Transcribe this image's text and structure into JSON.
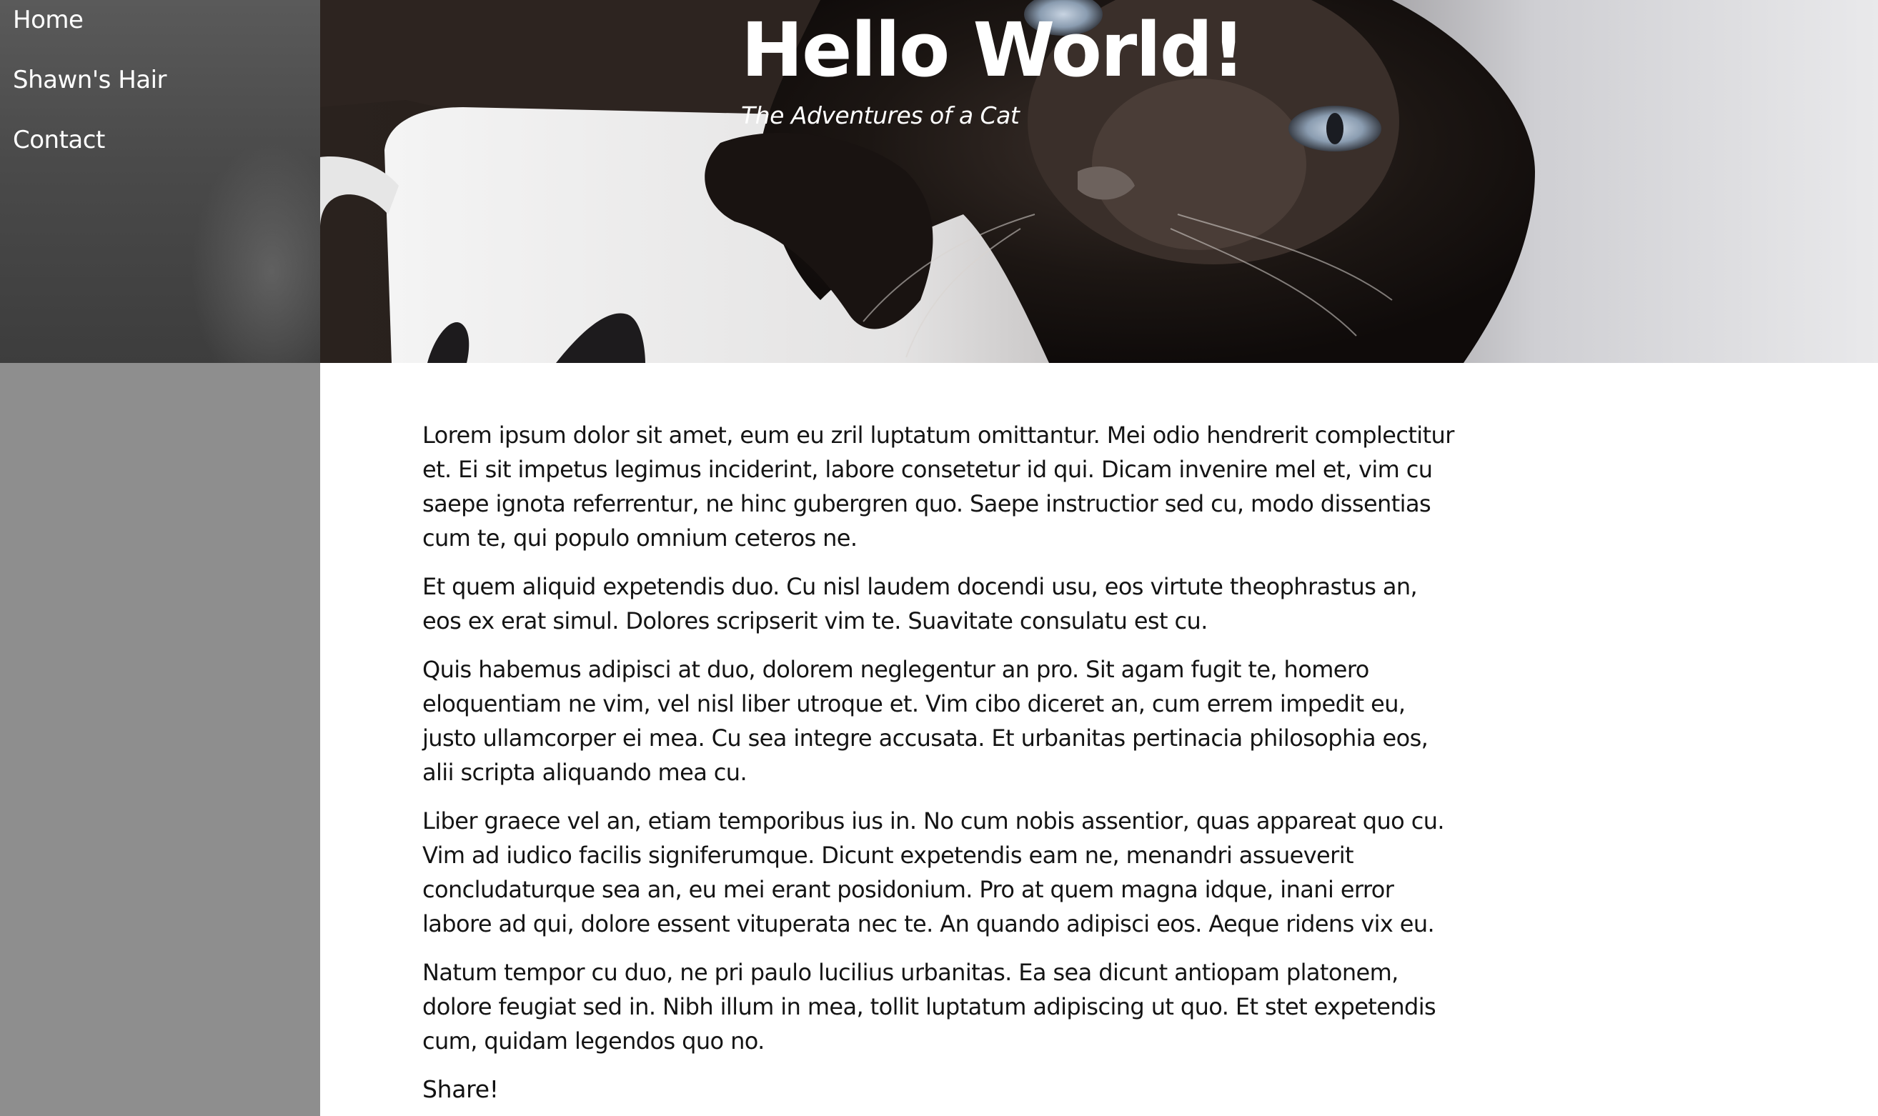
{
  "nav": {
    "items": [
      {
        "label": "Home"
      },
      {
        "label": "Shawn's Hair"
      },
      {
        "label": "Contact"
      }
    ]
  },
  "hero": {
    "title": "Hello World!",
    "subtitle": "The Adventures of a Cat"
  },
  "article": {
    "paragraphs": [
      "Lorem ipsum dolor sit amet, eum eu zril luptatum omittantur. Mei odio hendrerit complectitur et. Ei sit impetus legimus inciderint, labore consetetur id qui. Dicam invenire mel et, vim cu saepe ignota referrentur, ne hinc gubergren quo. Saepe instructior sed cu, modo dissentias cum te, qui populo omnium ceteros ne.",
      "Et quem aliquid expetendis duo. Cu nisl laudem docendi usu, eos virtute theophrastus an, eos ex erat simul. Dolores scripserit vim te. Suavitate consulatu est cu.",
      "Quis habemus adipisci at duo, dolorem neglegentur an pro. Sit agam fugit te, homero eloquentiam ne vim, vel nisl liber utroque et. Vim cibo diceret an, cum errem impedit eu, justo ullamcorper ei mea. Cu sea integre accusata. Et urbanitas pertinacia philosophia eos, alii scripta aliquando mea cu.",
      "Liber graece vel an, etiam temporibus ius in. No cum nobis assentior, quas appareat quo cu. Vim ad iudico facilis signiferumque. Dicunt expetendis eam ne, menandri assueverit concludaturque sea an, eu mei erant posidonium. Pro at quem magna idque, inani error labore ad qui, dolore essent vituperata nec te. An quando adipisci eos. Aeque ridens vix eu.",
      "Natum tempor cu duo, ne pri paulo lucilius urbanitas. Ea sea dicunt antiopam platonem, dolore feugiat sed in. Nibh illum in mea, tollit luptatum adipiscing ut quo. Et stet expetendis cum, quidam legendos quo no."
    ],
    "share_label": "Share!"
  },
  "colors": {
    "sidebar_background": "#8e8e8e",
    "nav_text": "#ffffff",
    "hero_text": "#ffffff",
    "body_text": "#141414",
    "page_background": "#ffffff"
  },
  "icons": {
    "hero_image": "cat-in-mug-image"
  }
}
